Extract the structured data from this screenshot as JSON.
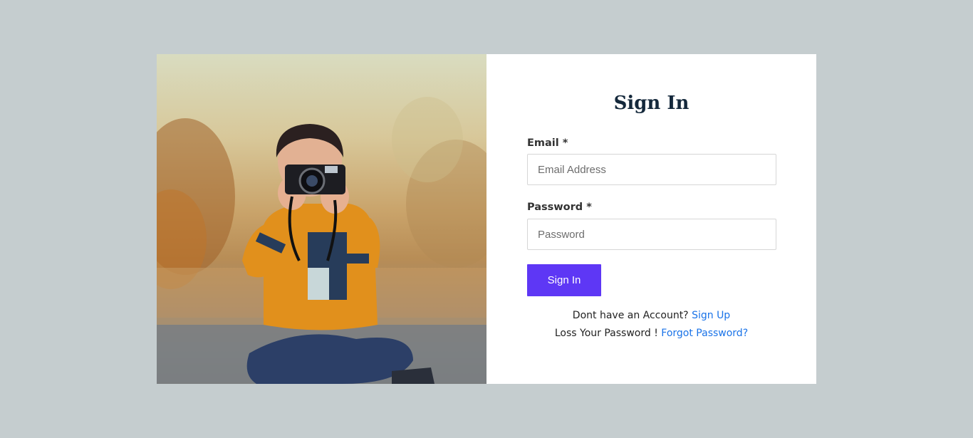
{
  "form": {
    "title": "Sign In",
    "email_label": "Email *",
    "email_placeholder": "Email Address",
    "email_value": "",
    "password_label": "Password *",
    "password_placeholder": "Password",
    "password_value": "",
    "submit_label": "Sign In",
    "signup_prompt": "Dont have an Account?",
    "signup_link": "Sign Up",
    "forgot_prompt": "Loss Your Password !",
    "forgot_link": "Forgot Password?"
  },
  "colors": {
    "page_background": "#c5cdcf",
    "button": "#5e37f5",
    "link": "#1a73e8",
    "title": "#14283b"
  },
  "icons": {
    "hero_image": "photographer-child-with-camera"
  }
}
